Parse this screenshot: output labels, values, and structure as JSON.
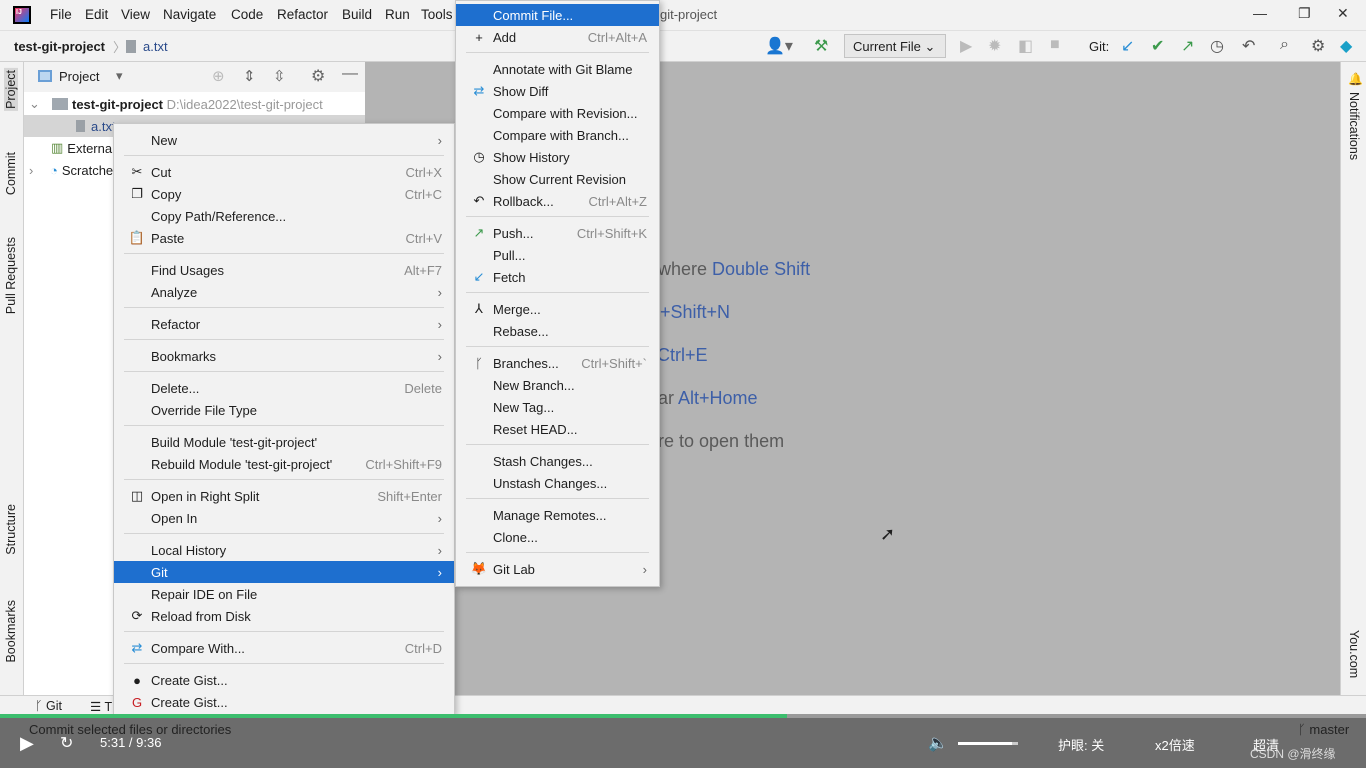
{
  "title": {
    "menus": [
      "File",
      "Edit",
      "View",
      "Navigate",
      "Code",
      "Refactor",
      "Build",
      "Run",
      "Tools"
    ],
    "window_title_fragment": "git-project",
    "logo": "IJ"
  },
  "nav": {
    "project": "test-git-project",
    "file": "a.txt",
    "run_config": "Current File",
    "git_label": "Git:"
  },
  "left_tabs": [
    "Project",
    "Commit",
    "Pull Requests",
    "Structure",
    "Bookmarks"
  ],
  "right_tabs": [
    "Notifications",
    "You.com"
  ],
  "project_panel": {
    "title": "Project",
    "root": "test-git-project",
    "root_path": "D:\\idea2022\\test-git-project",
    "file": "a.txt",
    "external": "External Libraries",
    "scratches": "Scratches and Consoles"
  },
  "editor_hints": [
    {
      "pre": "where ",
      "key": "Double Shift"
    },
    {
      "pre": "",
      "key": "rl+Shift+N"
    },
    {
      "pre": "",
      "key": "Ctrl+E"
    },
    {
      "pre": "ar ",
      "key": "Alt+Home"
    },
    {
      "pre": "re to open them",
      "key": ""
    }
  ],
  "context_menu": [
    {
      "label": "New",
      "submenu": true
    },
    {
      "sep": true
    },
    {
      "label": "Cut",
      "shortcut": "Ctrl+X",
      "icon": "scissors"
    },
    {
      "label": "Copy",
      "shortcut": "Ctrl+C",
      "icon": "copy"
    },
    {
      "label": "Copy Path/Reference..."
    },
    {
      "label": "Paste",
      "shortcut": "Ctrl+V",
      "icon": "paste"
    },
    {
      "sep": true
    },
    {
      "label": "Find Usages",
      "shortcut": "Alt+F7"
    },
    {
      "label": "Analyze",
      "submenu": true
    },
    {
      "sep": true
    },
    {
      "label": "Refactor",
      "submenu": true
    },
    {
      "sep": true
    },
    {
      "label": "Bookmarks",
      "submenu": true
    },
    {
      "sep": true
    },
    {
      "label": "Delete...",
      "shortcut": "Delete"
    },
    {
      "label": "Override File Type"
    },
    {
      "sep": true
    },
    {
      "label": "Build Module 'test-git-project'"
    },
    {
      "label": "Rebuild Module 'test-git-project'",
      "shortcut": "Ctrl+Shift+F9"
    },
    {
      "sep": true
    },
    {
      "label": "Open in Right Split",
      "shortcut": "Shift+Enter",
      "icon": "split"
    },
    {
      "label": "Open In",
      "submenu": true
    },
    {
      "sep": true
    },
    {
      "label": "Local History",
      "submenu": true
    },
    {
      "label": "Git",
      "submenu": true,
      "selected": true
    },
    {
      "label": "Repair IDE on File"
    },
    {
      "label": "Reload from Disk",
      "icon": "reload"
    },
    {
      "sep": true
    },
    {
      "label": "Compare With...",
      "shortcut": "Ctrl+D",
      "icon": "diff"
    },
    {
      "sep": true
    },
    {
      "label": "Create Gist...",
      "icon": "github"
    },
    {
      "label": "Create Gist...",
      "icon": "gitee"
    }
  ],
  "git_menu": [
    {
      "label": "Commit File...",
      "selected": true
    },
    {
      "label": "Add",
      "shortcut": "Ctrl+Alt+A",
      "icon": "plus"
    },
    {
      "sep": true
    },
    {
      "label": "Annotate with Git Blame"
    },
    {
      "label": "Show Diff",
      "icon": "diff"
    },
    {
      "label": "Compare with Revision..."
    },
    {
      "label": "Compare with Branch..."
    },
    {
      "label": "Show History",
      "icon": "clock"
    },
    {
      "label": "Show Current Revision"
    },
    {
      "label": "Rollback...",
      "shortcut": "Ctrl+Alt+Z",
      "icon": "undo"
    },
    {
      "sep": true
    },
    {
      "label": "Push...",
      "shortcut": "Ctrl+Shift+K",
      "icon": "push"
    },
    {
      "label": "Pull..."
    },
    {
      "label": "Fetch",
      "icon": "fetch"
    },
    {
      "sep": true
    },
    {
      "label": "Merge...",
      "icon": "merge"
    },
    {
      "label": "Rebase..."
    },
    {
      "sep": true
    },
    {
      "label": "Branches...",
      "shortcut": "Ctrl+Shift+`",
      "icon": "branch"
    },
    {
      "label": "New Branch..."
    },
    {
      "label": "New Tag..."
    },
    {
      "label": "Reset HEAD..."
    },
    {
      "sep": true
    },
    {
      "label": "Stash Changes..."
    },
    {
      "label": "Unstash Changes..."
    },
    {
      "sep": true
    },
    {
      "label": "Manage Remotes..."
    },
    {
      "label": "Clone..."
    },
    {
      "sep": true
    },
    {
      "label": "Git Lab",
      "submenu": true,
      "icon": "gitlab"
    }
  ],
  "bottom_bar": {
    "git": "Git",
    "todo": "T"
  },
  "status": {
    "text": "Commit selected files or directories",
    "branch": "master"
  },
  "player": {
    "time": "5:31 / 9:36",
    "eye_care": "护眼: 关",
    "speed": "x2倍速",
    "quality": "超清",
    "watermark": "CSDN @滑终缘",
    "progress": 0.576,
    "volume": 0.9
  },
  "colors": {
    "accent": "#1e6fcf",
    "progress": "#3cbe6e",
    "hint_key": "#3d5fa8"
  }
}
